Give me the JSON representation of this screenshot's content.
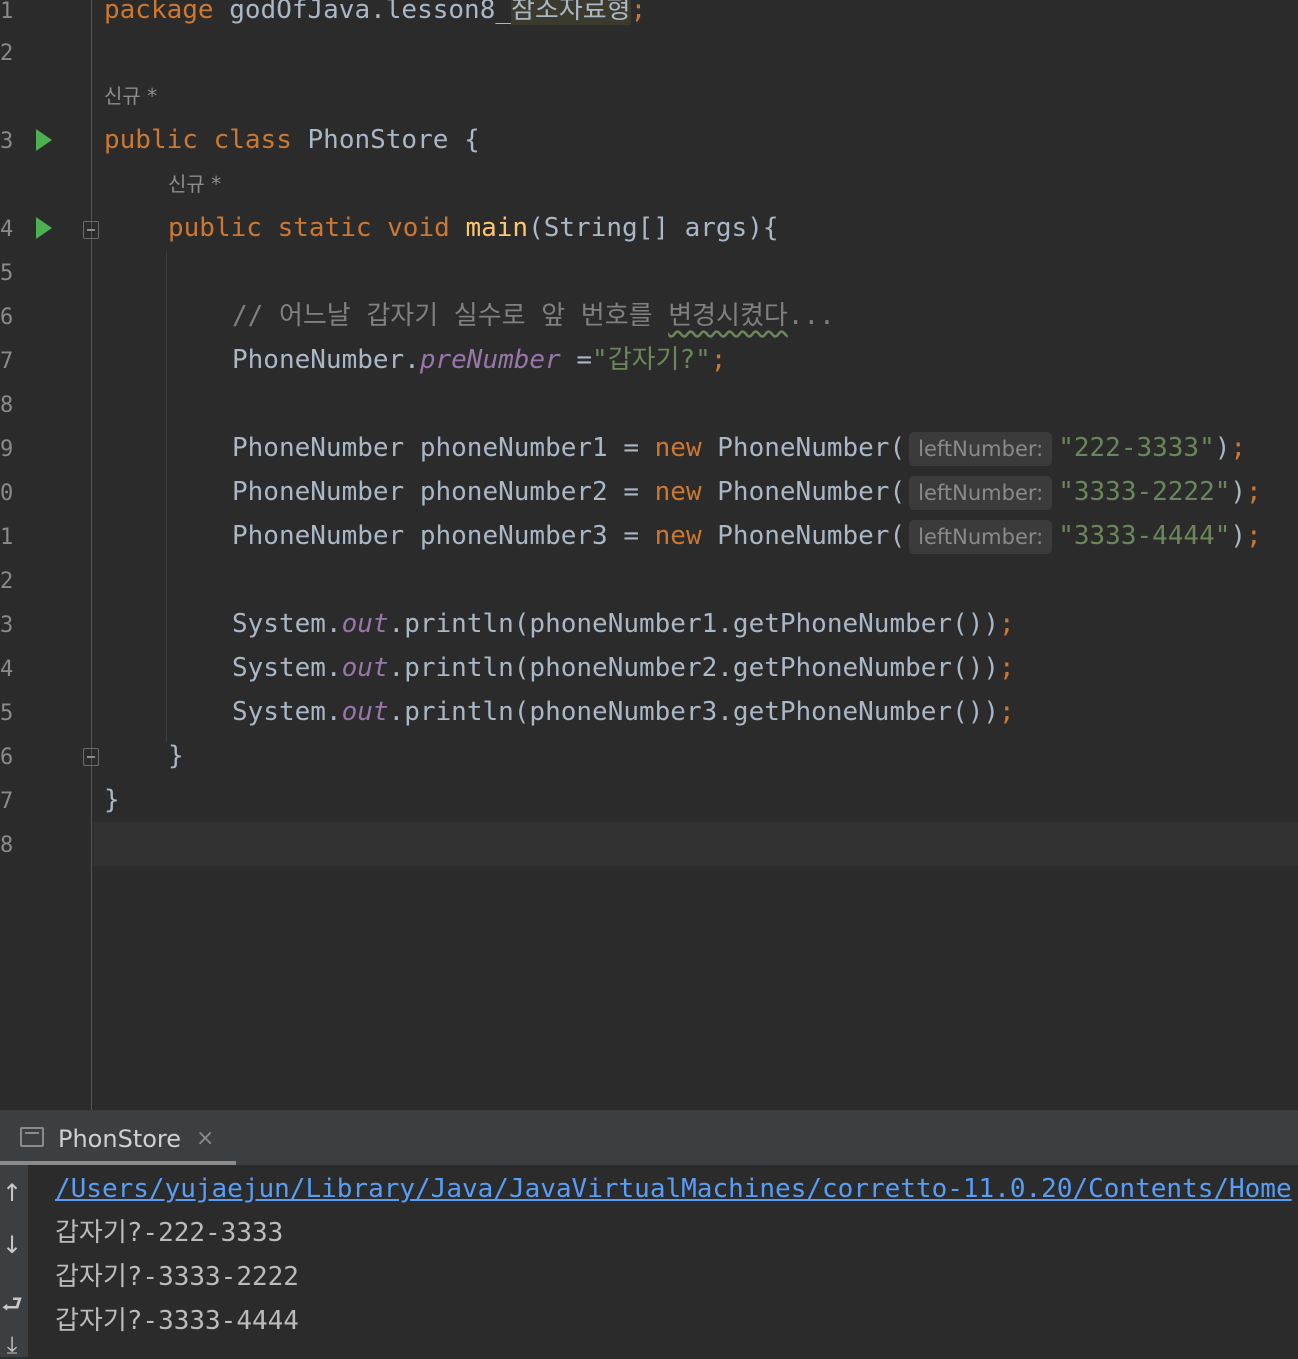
{
  "editor": {
    "line_numbers": [
      "1",
      "2",
      "3",
      "4",
      "5",
      "6",
      "7",
      "8",
      "9",
      "0",
      "1",
      "2",
      "3",
      "4",
      "5",
      "6",
      "7",
      "8"
    ],
    "code_lens": "신규 *",
    "package_kw": "package",
    "package_prefix": "godOfJava.lesson8_",
    "package_highlight": "참조자료형",
    "semicolon": ";",
    "class_public": "public",
    "class_kw": "class",
    "class_name": "PhonStore",
    "open_brace": "{",
    "close_brace": "}",
    "main_public": "public",
    "main_static": "static",
    "main_void": "void",
    "main_name": "main",
    "main_params": "(String[] args){",
    "comment_start": "// 어느날 갑자기 실수로 앞 번호를 ",
    "comment_squiggle": "변경시켰다",
    "comment_end": "...",
    "assign_target": "PhoneNumber.",
    "assign_field": "preNumber",
    "assign_op": " =",
    "assign_value": "\"갑자기?\"",
    "decl_type": "PhoneNumber ",
    "decl_eq": " = ",
    "new_kw": "new",
    "ctor_call": " PhoneNumber(",
    "param_hint": "leftNumber:",
    "close_paren": ")",
    "declarations": [
      {
        "var": "phoneNumber1",
        "value": "\"222-3333\""
      },
      {
        "var": "phoneNumber2",
        "value": "\"3333-2222\""
      },
      {
        "var": "phoneNumber3",
        "value": "\"3333-4444\""
      }
    ],
    "print_prefix": "System.",
    "print_out": "out",
    "print_calls": [
      ".println(phoneNumber1.getPhoneNumber())",
      ".println(phoneNumber2.getPhoneNumber())",
      ".println(phoneNumber3.getPhoneNumber())"
    ]
  },
  "run_panel": {
    "tab_label": "PhonStore",
    "tab_close": "×",
    "tool_icons": [
      "up-arrow-icon",
      "down-arrow-icon",
      "soft-wrap-icon",
      "scroll-to-end-icon"
    ],
    "tool_glyphs": [
      "↑",
      "↓",
      "⮐",
      "⤓"
    ],
    "output_lines": [
      "/Users/yujaejun/Library/Java/JavaVirtualMachines/corretto-11.0.20/Contents/Home",
      "갑자기?-222-3333",
      "갑자기?-3333-2222",
      "갑자기?-3333-4444"
    ]
  },
  "colors": {
    "background": "#2b2b2b",
    "keyword": "#cc7832",
    "string": "#6a8759",
    "method": "#ffc66d",
    "field": "#9876aa",
    "link": "#589df6",
    "run_gutter": "#4caf50"
  }
}
